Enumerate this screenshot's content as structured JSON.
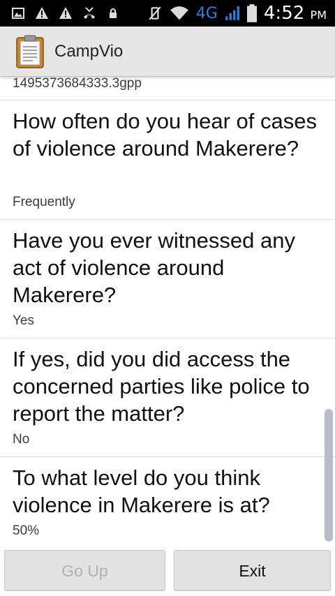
{
  "status_bar": {
    "network": "4G",
    "time": "4:52",
    "ampm": "PM"
  },
  "app": {
    "title": "CampVio"
  },
  "list": {
    "partial_answer": "1495373684333.3gpp",
    "items": [
      {
        "question": "How often do you hear of cases of violence around Makerere?",
        "answer": "Frequently"
      },
      {
        "question": "Have you ever witnessed any act of violence around Makerere?",
        "answer": "Yes"
      },
      {
        "question": "If yes, did you did access the concerned parties like police to report the matter?",
        "answer": "No"
      },
      {
        "question": "To what level do you think violence in Makerere is at?",
        "answer": "50%"
      }
    ]
  },
  "buttons": {
    "go_up": "Go Up",
    "exit": "Exit"
  }
}
